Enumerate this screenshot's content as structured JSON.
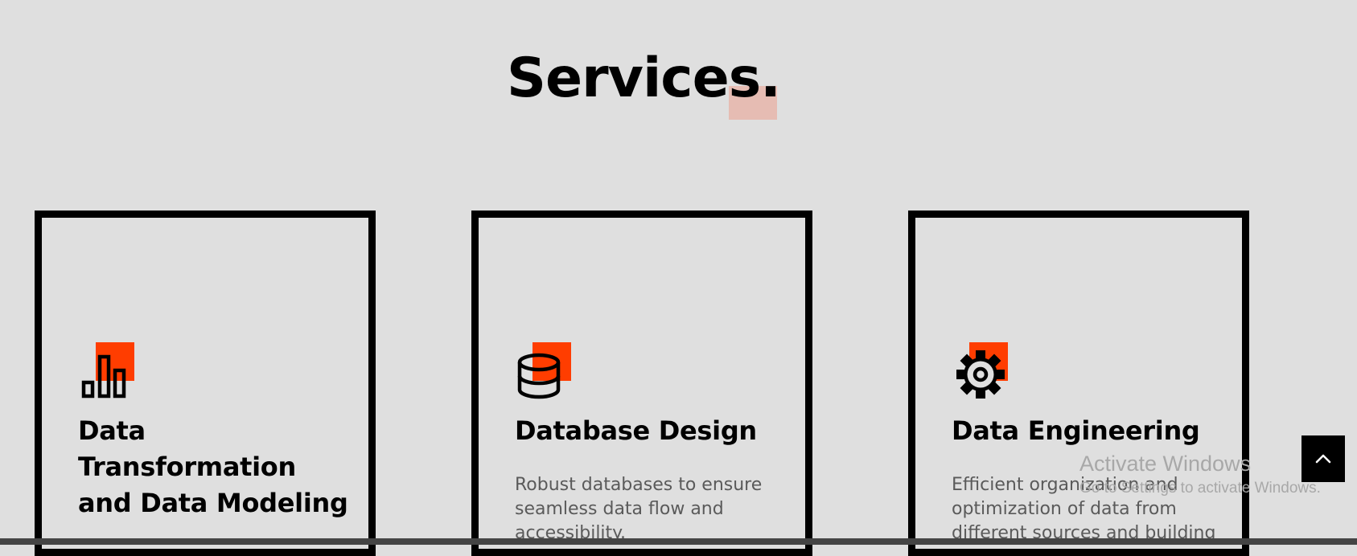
{
  "section": {
    "title": "Services."
  },
  "services": [
    {
      "title": "Data Transformation and Data Modeling",
      "description": "",
      "icon": "bar-chart-icon"
    },
    {
      "title": "Database Design",
      "description": "Robust databases to ensure\nseamless data flow and\naccessibility.",
      "icon": "database-icon"
    },
    {
      "title": "Data Engineering",
      "description": "Efficient organization and\noptimization of data from\ndifferent sources and building",
      "icon": "gear-icon"
    }
  ],
  "watermark": {
    "title": "Activate Windows",
    "subtitle": "Go to Settings to activate Windows."
  },
  "scroll_top": {
    "icon": "chevron-up-icon"
  },
  "colors": {
    "background": "#dfdfdf",
    "accent": "#ff3d00",
    "title_accent": "#e6bcb3",
    "border": "#000000",
    "description": "#5a5a5a"
  }
}
